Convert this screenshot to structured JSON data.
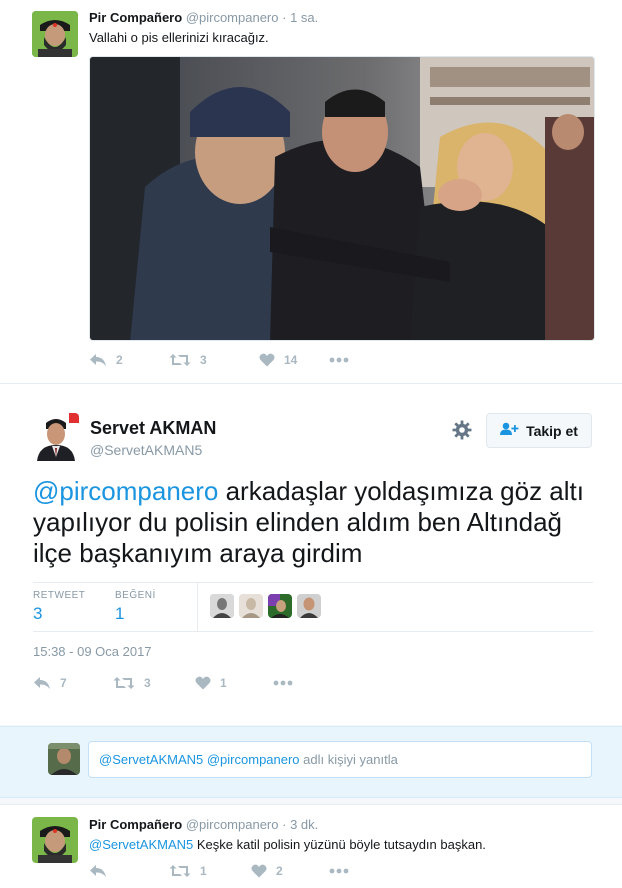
{
  "tweet1": {
    "name": "Pir Compañero",
    "handle": "@pircompanero",
    "time": "· 1 sa.",
    "text": "Vallahi o pis ellerinizi kıracağız.",
    "reply_count": "2",
    "retweet_count": "3",
    "like_count": "14"
  },
  "main_tweet": {
    "name": "Servet AKMAN",
    "handle": "@ServetAKMAN5",
    "follow_label": "Takip et",
    "mention": "@pircompanero",
    "text": " arkadaşlar yoldaşımıza göz altı yapılıyor du polisin elinden aldım ben Altındağ ilçe başkanıyım araya girdim",
    "retweet_label": "RETWEET",
    "retweet_value": "3",
    "like_label": "BEĞENİ",
    "like_value": "1",
    "timestamp": "15:38 - 09 Oca 2017",
    "reply_count": "7",
    "retweet_count": "3",
    "like_count": "1"
  },
  "reply_box": {
    "mention1": "@ServetAKMAN5",
    "mention2": "@pircompanero",
    "suffix": " adlı kişiyi yanıtla"
  },
  "tweet2": {
    "name": "Pir Compañero",
    "handle": "@pircompanero",
    "time": "· 3 dk.",
    "mention": "@ServetAKMAN5",
    "text": " Keşke katil polisin yüzünü böyle tutsaydın başkan.",
    "reply_count": "",
    "retweet_count": "1",
    "like_count": "2"
  },
  "colors": {
    "link": "#1b95e0",
    "muted": "#8899a6",
    "icon": "#aab8c2"
  }
}
